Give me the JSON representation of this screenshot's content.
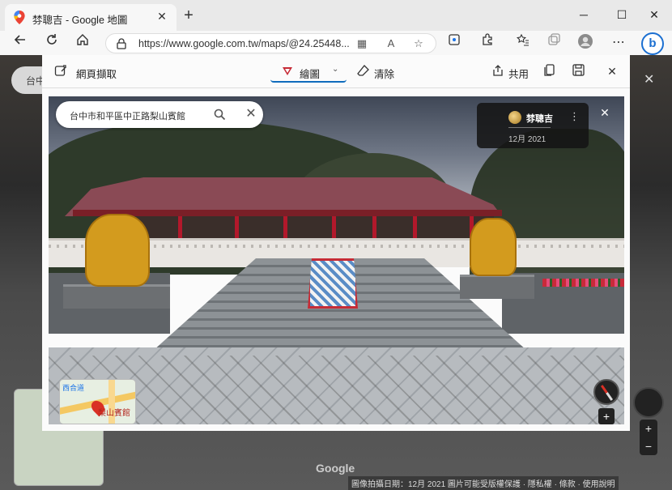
{
  "browser": {
    "tab_title": "棼聰吉 - Google 地圖",
    "tab_close": "✕",
    "new_tab": "+",
    "url": "https://www.google.com.tw/maps/@24.25448...",
    "bing_label": "b",
    "window_controls": {
      "minimize": "─",
      "maximize": "☐",
      "close": "✕"
    },
    "icons": [
      "back-icon",
      "refresh-icon",
      "home-icon",
      "lock-icon",
      "apps-icon",
      "read-aloud-icon",
      "favorite-icon",
      "extension-icon",
      "extensions-icon",
      "favorites-icon",
      "collections-icon",
      "profile-icon",
      "menu-icon"
    ]
  },
  "capture": {
    "web_capture_label": "網頁擷取",
    "draw_label": "繪圖",
    "erase_label": "清除",
    "share_label": "共用",
    "accent": "#0f6cbd"
  },
  "streetview": {
    "search_query": "台中市和平區中正路梨山賓館",
    "close_search": "✕",
    "contributor_name": "棼聰吉",
    "contributor_date": "12月 2021",
    "more": "⋮",
    "close": "✕",
    "minimap_place": "梨山賓館",
    "minimap_road_label": "西合道",
    "zoom_in": "+"
  },
  "background": {
    "pill_text": "台中",
    "close": "✕",
    "google_logo": "Google",
    "footer_text": "圖像拍攝日期：12月 2021   圖片可能受版權保護 · 隱私權 · 條款 · 使用說明",
    "zoom_in": "+",
    "zoom_out": "−"
  }
}
